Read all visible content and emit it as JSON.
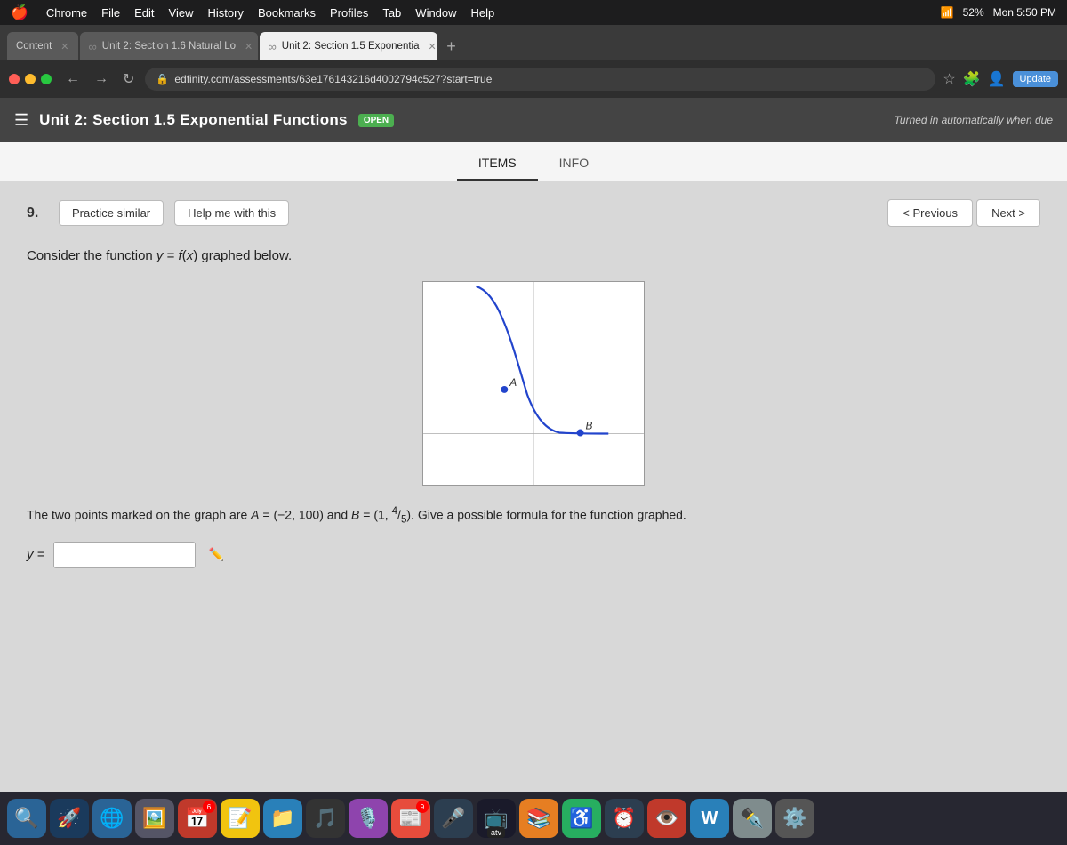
{
  "menubar": {
    "apple": "🍎",
    "items": [
      "Chrome",
      "File",
      "Edit",
      "View",
      "History",
      "Bookmarks",
      "Profiles",
      "Tab",
      "Window",
      "Help"
    ],
    "right": {
      "wifi": "wifi",
      "battery": "52%",
      "time": "Mon 5:50 PM"
    }
  },
  "tabs": [
    {
      "id": "content",
      "label": "Content",
      "active": false,
      "infinity": false
    },
    {
      "id": "unit16",
      "label": "Unit 2: Section 1.6 Natural Lo",
      "active": false,
      "infinity": true
    },
    {
      "id": "unit15",
      "label": "Unit 2: Section 1.5 Exponentia",
      "active": true,
      "infinity": true
    }
  ],
  "addressbar": {
    "url": "edfinity.com/assessments/63e176143216d4002794c527?start=true",
    "lock_icon": "🔒",
    "update_label": "Update"
  },
  "page_header": {
    "title": "Unit 2: Section 1.5 Exponential Functions",
    "badge": "OPEN",
    "turned_in": "Turned in automatically when due"
  },
  "content_tabs": [
    {
      "id": "items",
      "label": "ITEMS",
      "active": true
    },
    {
      "id": "info",
      "label": "INFO",
      "active": false
    }
  ],
  "question": {
    "number": "9.",
    "practice_label": "Practice similar",
    "help_label": "Help me with this",
    "prev_label": "< Previous",
    "next_label": "Next >",
    "text": "Consider the function y = f(x) graphed below.",
    "point_a": "A",
    "point_b": "B",
    "bottom_text": "The two points marked on the graph are A = (−2, 100) and B = (1, 4/5). Give a possible formula for the function graphed.",
    "answer_label": "y =",
    "answer_placeholder": ""
  },
  "dock": {
    "items": [
      {
        "id": "finder",
        "icon": "🔍",
        "bg": "#2a6496",
        "label": ""
      },
      {
        "id": "launchpad",
        "icon": "🚀",
        "bg": "#1a3a5c",
        "label": ""
      },
      {
        "id": "chrome",
        "icon": "🌐",
        "bg": "#2a6496",
        "label": ""
      },
      {
        "id": "photos",
        "icon": "🖼️",
        "bg": "#3d5a80",
        "label": ""
      },
      {
        "id": "calendar",
        "icon": "📅",
        "bg": "#c0392b",
        "label": "6"
      },
      {
        "id": "notes",
        "icon": "📝",
        "bg": "#f1c40f",
        "label": ""
      },
      {
        "id": "files",
        "icon": "📁",
        "bg": "#2980b9",
        "label": ""
      },
      {
        "id": "music",
        "icon": "🎵",
        "bg": "#e74c3c",
        "label": ""
      },
      {
        "id": "podcasts",
        "icon": "🎙️",
        "bg": "#8e44ad",
        "label": ""
      },
      {
        "id": "news",
        "icon": "📰",
        "bg": "#e74c3c",
        "label": "9"
      },
      {
        "id": "siri",
        "icon": "🎤",
        "bg": "#2c3e50",
        "label": ""
      },
      {
        "id": "atv",
        "icon": "📺",
        "bg": "#2c3e50",
        "label": "atv"
      },
      {
        "id": "books",
        "icon": "📚",
        "bg": "#e67e22",
        "label": ""
      },
      {
        "id": "accessibility",
        "icon": "♿",
        "bg": "#27ae60",
        "label": ""
      },
      {
        "id": "clock",
        "icon": "⏰",
        "bg": "#2c3e50",
        "label": ""
      },
      {
        "id": "preview",
        "icon": "👁️",
        "bg": "#c0392b",
        "label": ""
      },
      {
        "id": "word",
        "icon": "W",
        "bg": "#2980b9",
        "label": ""
      },
      {
        "id": "pen",
        "icon": "✒️",
        "bg": "#7f8c8d",
        "label": ""
      },
      {
        "id": "settings",
        "icon": "⚙️",
        "bg": "#95a5a6",
        "label": ""
      }
    ]
  }
}
